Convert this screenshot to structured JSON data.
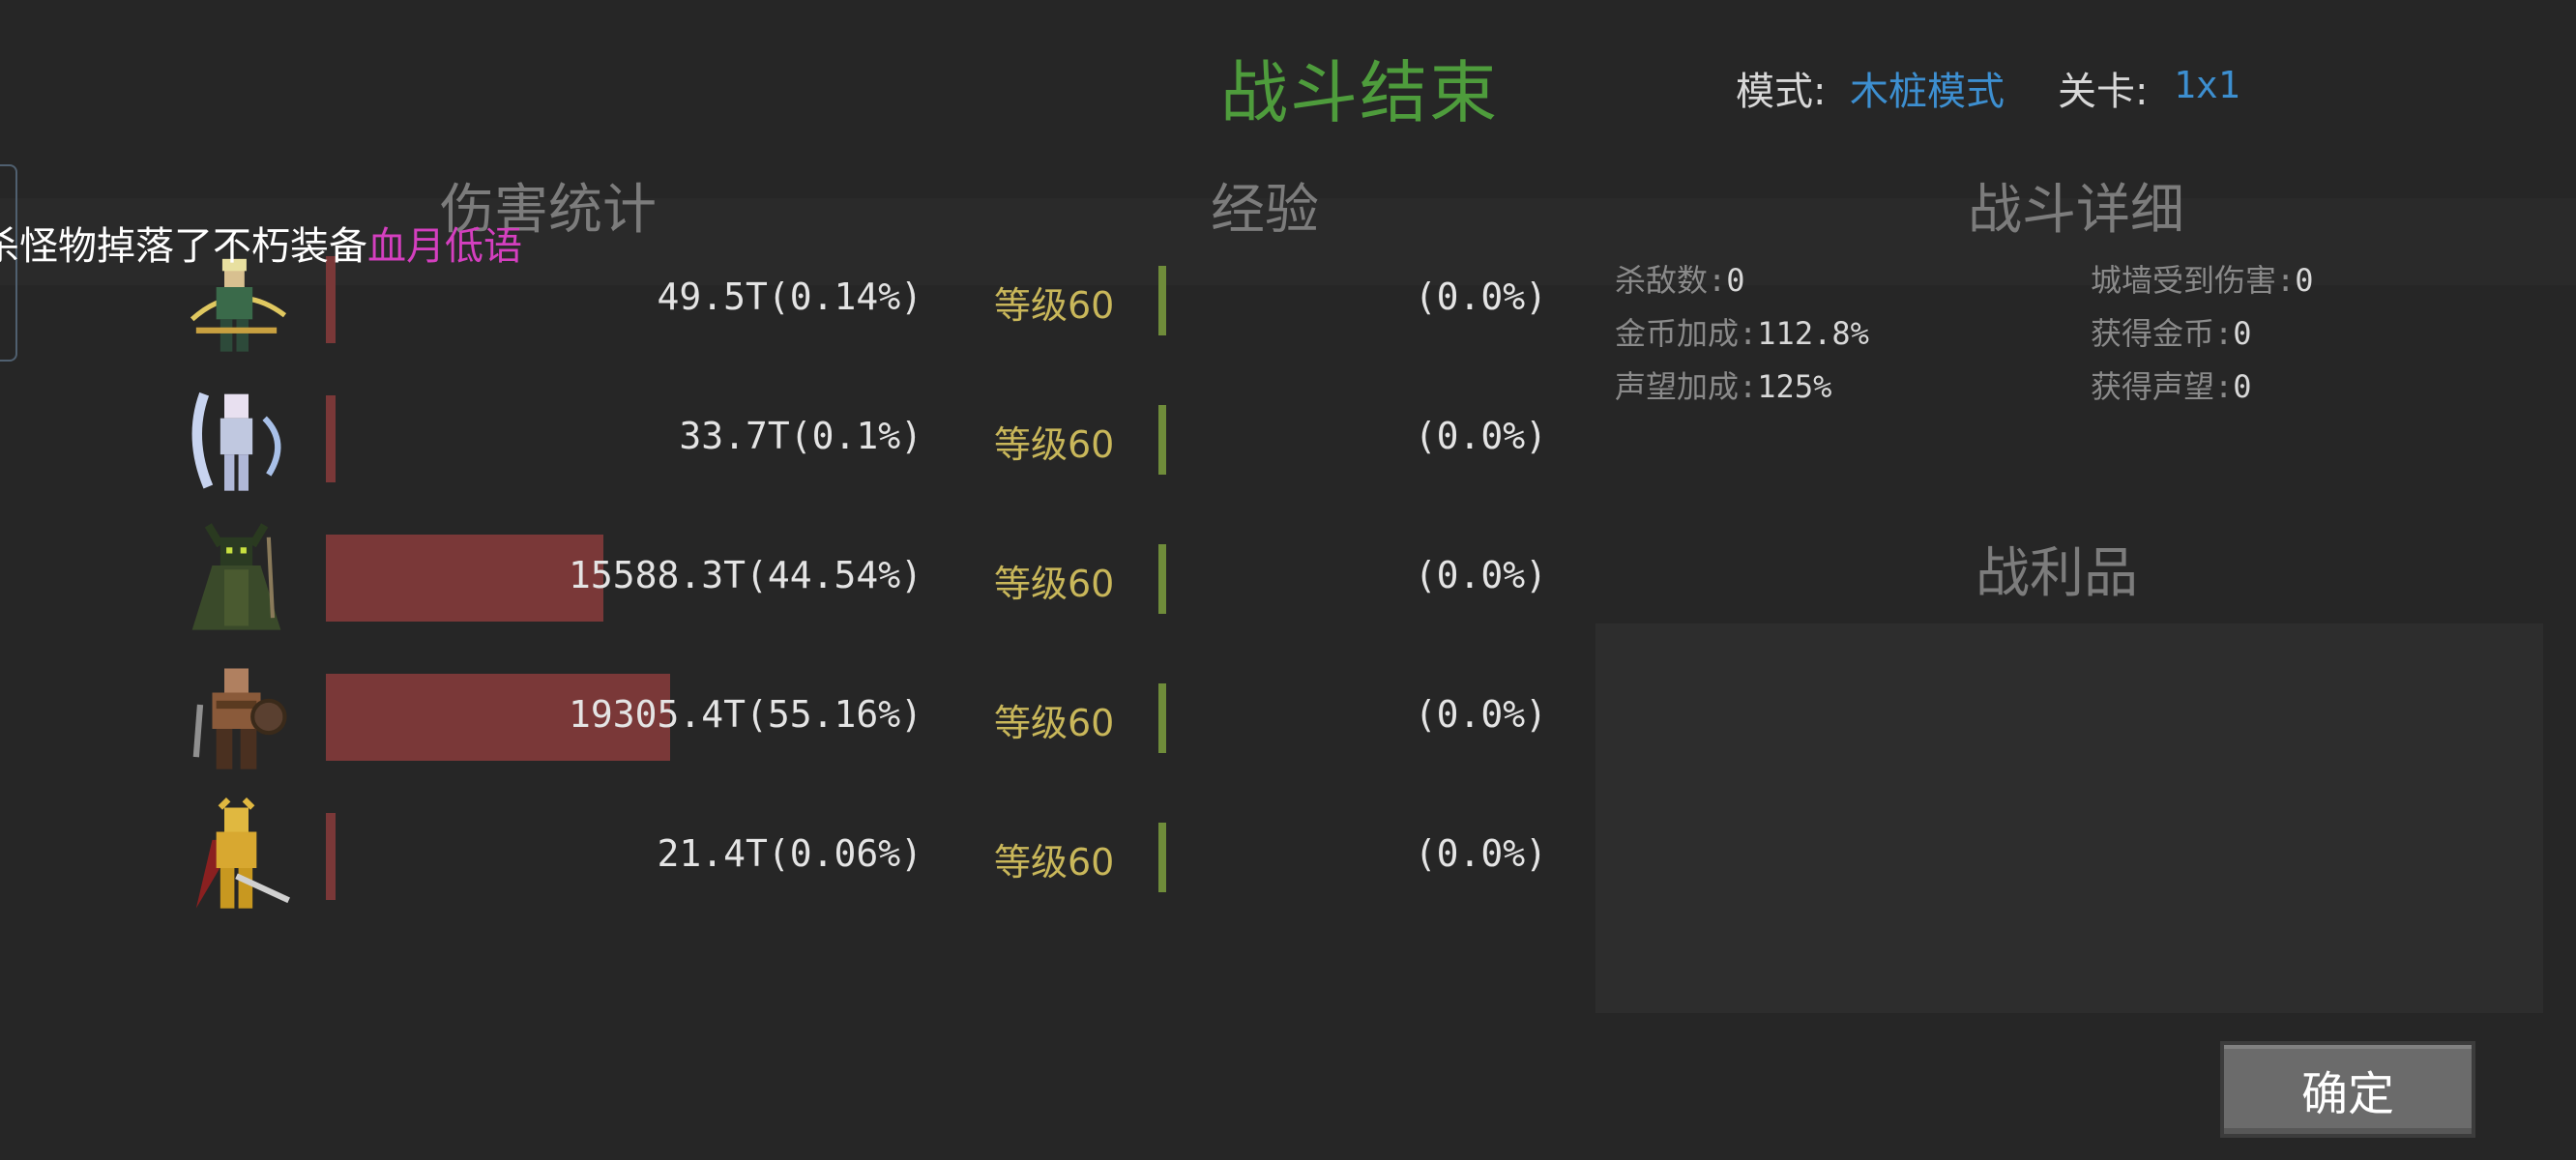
{
  "header": {
    "title": "战斗结束",
    "mode_label": "模式:",
    "mode_value": "木桩模式",
    "stage_label": "关卡:",
    "stage_value": "1x1"
  },
  "sections": {
    "damage": "伤害统计",
    "experience": "经验",
    "detail": "战斗详细",
    "loot": "战利品"
  },
  "notification": {
    "text": "杀怪物掉落了不朽装备",
    "item": "血月低语",
    "item_color": "#d43fbf"
  },
  "heroes": [
    {
      "avatar": "archer-hero-icon",
      "damage": "49.5T(0.14%)",
      "damage_share": 0.14,
      "level": "等级60",
      "exp": "(0.0%)"
    },
    {
      "avatar": "ice-mage-hero-icon",
      "damage": "33.7T(0.1%)",
      "damage_share": 0.1,
      "level": "等级60",
      "exp": "(0.0%)"
    },
    {
      "avatar": "dark-druid-hero-icon",
      "damage": "15588.3T(44.54%)",
      "damage_share": 44.54,
      "level": "等级60",
      "exp": "(0.0%)"
    },
    {
      "avatar": "barbarian-hero-icon",
      "damage": "19305.4T(55.16%)",
      "damage_share": 55.16,
      "level": "等级60",
      "exp": "(0.0%)"
    },
    {
      "avatar": "paladin-hero-icon",
      "damage": "21.4T(0.06%)",
      "damage_share": 0.06,
      "level": "等级60",
      "exp": "(0.0%)"
    }
  ],
  "battle_detail": {
    "kills_label": "杀敌数:",
    "kills": "0",
    "wall_damage_label": "城墙受到伤害:",
    "wall_damage": "0",
    "gold_bonus_label": "金币加成:",
    "gold_bonus": "112.8%",
    "gold_gained_label": "获得金币:",
    "gold_gained": "0",
    "fame_bonus_label": "声望加成:",
    "fame_bonus": "125%",
    "fame_gained_label": "获得声望:",
    "fame_gained": "0"
  },
  "confirm_label": "确定",
  "colors": {
    "title": "#4e9c3c",
    "link": "#3d8fd0",
    "damage_bar": "#7a3838",
    "level": "#c9b75a",
    "exp_bar": "#6f8c3a"
  }
}
